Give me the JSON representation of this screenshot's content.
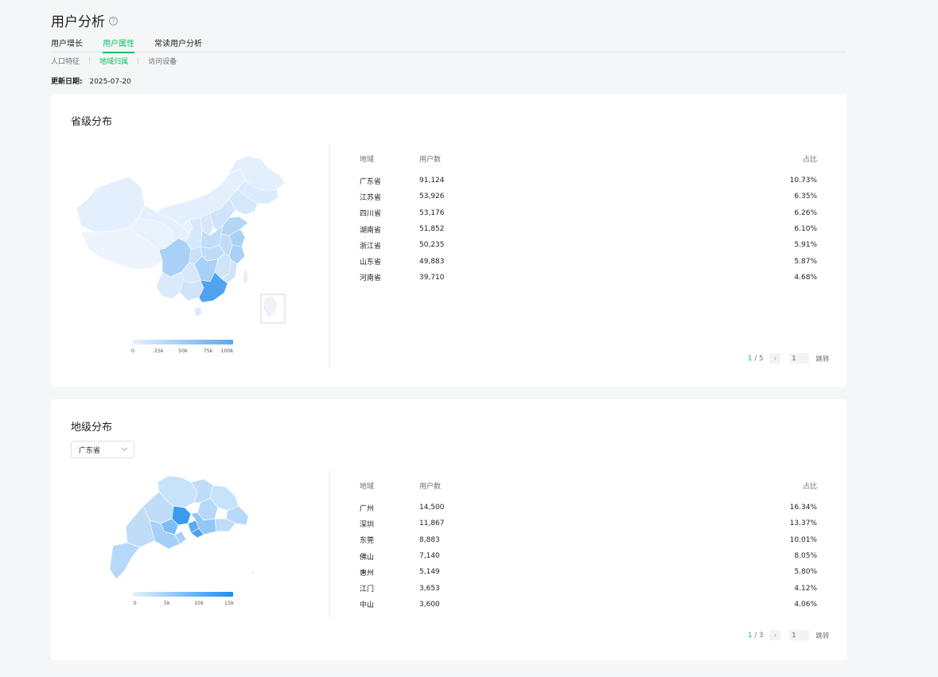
{
  "header": {
    "title": "用户分析",
    "help": "?"
  },
  "main_tabs": [
    {
      "label": "用户增长",
      "active": false
    },
    {
      "label": "用户属性",
      "active": true
    },
    {
      "label": "常读用户分析",
      "active": false
    }
  ],
  "sub_tabs": [
    {
      "label": "人口特征",
      "active": false
    },
    {
      "label": "地域归属",
      "active": true
    },
    {
      "label": "访问设备",
      "active": false
    }
  ],
  "update": {
    "label": "更新日期:",
    "value": "2025-07-20"
  },
  "province": {
    "title": "省级分布",
    "legend": [
      "0",
      "25k",
      "50k",
      "75k",
      "100k"
    ],
    "columns": {
      "region": "地域",
      "users": "用户数",
      "ratio": "占比"
    },
    "rows": [
      {
        "region": "广东省",
        "users": "91,124",
        "ratio": "10.73%"
      },
      {
        "region": "江苏省",
        "users": "53,926",
        "ratio": "6.35%"
      },
      {
        "region": "四川省",
        "users": "53,176",
        "ratio": "6.26%"
      },
      {
        "region": "湖南省",
        "users": "51,852",
        "ratio": "6.10%"
      },
      {
        "region": "浙江省",
        "users": "50,235",
        "ratio": "5.91%"
      },
      {
        "region": "山东省",
        "users": "49,883",
        "ratio": "5.87%"
      },
      {
        "region": "河南省",
        "users": "39,710",
        "ratio": "4.68%"
      }
    ],
    "pager": {
      "current": "1",
      "total": "/ 5",
      "input": "1",
      "jump": "跳转"
    }
  },
  "city": {
    "title": "地级分布",
    "select_value": "广东省",
    "legend": [
      "0",
      "5k",
      "10k",
      "15k"
    ],
    "columns": {
      "region": "地域",
      "users": "用户数",
      "ratio": "占比"
    },
    "rows": [
      {
        "region": "广州",
        "users": "14,500",
        "ratio": "16.34%"
      },
      {
        "region": "深圳",
        "users": "11,867",
        "ratio": "13.37%"
      },
      {
        "region": "东莞",
        "users": "8,883",
        "ratio": "10.01%"
      },
      {
        "region": "佛山",
        "users": "7,140",
        "ratio": "8.05%"
      },
      {
        "region": "惠州",
        "users": "5,149",
        "ratio": "5.80%"
      },
      {
        "region": "江门",
        "users": "3,653",
        "ratio": "4.12%"
      },
      {
        "region": "中山",
        "users": "3,600",
        "ratio": "4.06%"
      }
    ],
    "pager": {
      "current": "1",
      "total": "/ 3",
      "input": "1",
      "jump": "跳转"
    }
  },
  "colors": {
    "accent": "#07c160",
    "map_light": "#e3effc",
    "map_mid": "#a9d0f5",
    "map_dark": "#4fa3ef"
  }
}
